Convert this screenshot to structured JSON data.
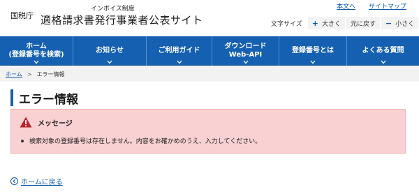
{
  "header": {
    "agency": "国税庁",
    "subtitle": "インボイス制度",
    "site_title": "適格請求書発行事業者公表サイト",
    "links": [
      "本文へ",
      "サイトマップ"
    ],
    "font_size": {
      "label": "文字サイズ",
      "larger": "大きく",
      "reset": "元に戻す",
      "smaller": "小さく",
      "larger_symbol": "+",
      "smaller_symbol": "−"
    }
  },
  "nav": {
    "items": [
      {
        "line1": "ホーム",
        "line2": "(登録番号を検索)"
      },
      {
        "line1": "お知らせ",
        "line2": ""
      },
      {
        "line1": "ご利用ガイド",
        "line2": ""
      },
      {
        "line1": "ダウンロード",
        "line2": "Web-API"
      },
      {
        "line1": "登録番号とは",
        "line2": ""
      },
      {
        "line1": "よくある質問",
        "line2": ""
      }
    ],
    "background": "#1560b0"
  },
  "breadcrumb": {
    "home": "ホーム",
    "separator": ">",
    "current": "エラー情報"
  },
  "page": {
    "title": "エラー情報"
  },
  "alert": {
    "title": "メッセージ",
    "message": "検索対象の登録番号は存在しません。内容をお確かめのうえ、入力してください。",
    "icon": "warning-icon",
    "background": "#f9d1d3"
  },
  "back_link": {
    "label": "ホームに戻る",
    "icon": "chevron-left-icon"
  }
}
